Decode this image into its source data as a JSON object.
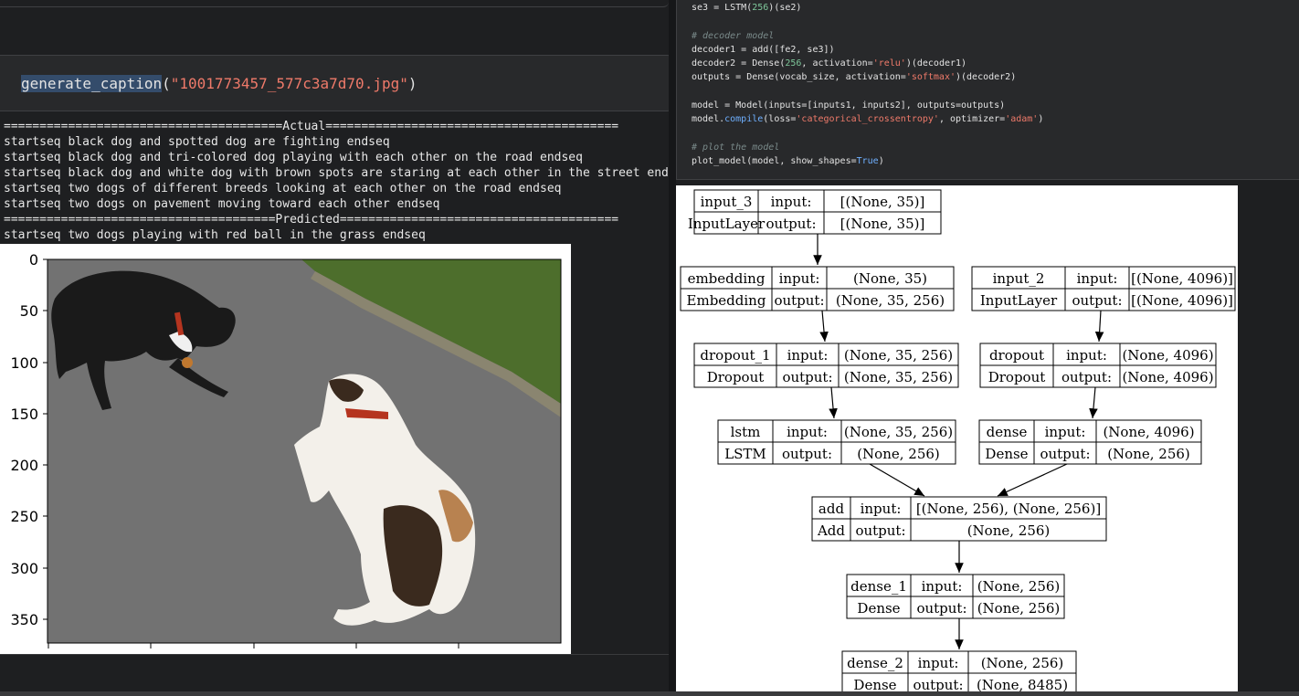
{
  "code_cell": {
    "function": "generate_caption",
    "open": "(",
    "argument": "\"1001773457_577c3a7d70.jpg\"",
    "close": ")"
  },
  "output": {
    "lines": [
      "=======================================Actual=========================================",
      "startseq black dog and spotted dog are fighting endseq",
      "startseq black dog and tri-colored dog playing with each other on the road endseq",
      "startseq black dog and white dog with brown spots are staring at each other in the street endseq",
      "startseq two dogs of different breeds looking at each other on the road endseq",
      "startseq two dogs on pavement moving toward each other endseq",
      "======================================Predicted=======================================",
      "startseq two dogs playing with red ball in the grass endseq"
    ]
  },
  "image_figure": {
    "y_ticks": [
      "0",
      "50",
      "100",
      "150",
      "200",
      "250",
      "300",
      "350"
    ],
    "x_ticks": [
      "",
      "",
      "",
      "",
      ""
    ],
    "colors": {
      "road": "#6b6b6b",
      "grass": "#4a6b2a",
      "black_dog": "#1b1b1b",
      "white_dog": "#f2efe8",
      "brown_spots": "#3a2a1e",
      "collar": "#b5341f"
    }
  },
  "code_panel": {
    "line1": {
      "a": "se3 = LSTM(",
      "n": "256",
      "b": ")(se2)"
    },
    "comment1": "# decoder model",
    "line2": "decoder1 = add([fe2, se3])",
    "line3": {
      "a": "decoder2 = Dense(",
      "n": "256",
      "b": ", activation=",
      "s": "'relu'",
      "c": ")(decoder1)"
    },
    "line4": {
      "a": "outputs = Dense(vocab_size, activation=",
      "s": "'softmax'",
      "c": ")(decoder2)"
    },
    "line5": "model = Model(inputs=[inputs1, inputs2], outputs=outputs)",
    "line6": {
      "a": "model.",
      "k": "compile",
      "b": "(loss=",
      "s": "'categorical_crossentropy'",
      "c": ", optimizer=",
      "s2": "'adam'",
      "d": ")"
    },
    "comment2": "# plot the model",
    "line7": {
      "a": "plot_model(model, show_shapes=",
      "k": "True",
      "b": ")"
    }
  },
  "model_plot": {
    "nodes": [
      {
        "name": "input_3",
        "type": "InputLayer",
        "in": "[(None, 35)]",
        "out": "[(None, 35)]"
      },
      {
        "name": "embedding",
        "type": "Embedding",
        "in": "(None, 35)",
        "out": "(None, 35, 256)"
      },
      {
        "name": "input_2",
        "type": "InputLayer",
        "in": "[(None, 4096)]",
        "out": "[(None, 4096)]"
      },
      {
        "name": "dropout_1",
        "type": "Dropout",
        "in": "(None, 35, 256)",
        "out": "(None, 35, 256)"
      },
      {
        "name": "dropout",
        "type": "Dropout",
        "in": "(None, 4096)",
        "out": "(None, 4096)"
      },
      {
        "name": "lstm",
        "type": "LSTM",
        "in": "(None, 35, 256)",
        "out": "(None, 256)"
      },
      {
        "name": "dense",
        "type": "Dense",
        "in": "(None, 4096)",
        "out": "(None, 256)"
      },
      {
        "name": "add",
        "type": "Add",
        "in": "[(None, 256), (None, 256)]",
        "out": "(None, 256)"
      },
      {
        "name": "dense_1",
        "type": "Dense",
        "in": "(None, 256)",
        "out": "(None, 256)"
      },
      {
        "name": "dense_2",
        "type": "Dense",
        "in": "(None, 256)",
        "out": "(None, 8485)"
      }
    ],
    "input_label": "input:",
    "output_label": "output:"
  }
}
